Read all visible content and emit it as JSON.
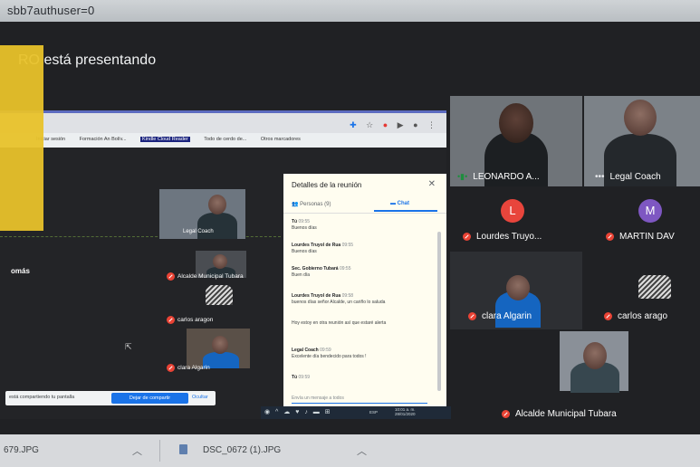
{
  "address": {
    "text": "sbb7authuser=0"
  },
  "meet": {
    "presenting_text": "RO está presentando",
    "side_name": "omás"
  },
  "shared_screen": {
    "bookmarks": [
      "Iniciar sesión",
      "Formación An Bolív...",
      "Kindle Cloud Reader",
      "Todo de cerdo de...",
      "Otros marcadores"
    ],
    "thumbs": [
      {
        "name": "Legal Coach"
      },
      {
        "name": "Alcalde Municipal Tubara"
      },
      {
        "name": "carlos aragon"
      },
      {
        "name": "clara Algarin"
      }
    ],
    "share_bar": {
      "text": "está compartiendo tu pantalla",
      "stop_label": "Dejar de compartir",
      "hide_label": "Ocultar"
    },
    "taskbar": {
      "time": "10:01 a. m.",
      "date": "28/01/2020",
      "lang": "ESP"
    }
  },
  "details_panel": {
    "title": "Detalles de la reunión",
    "tab_people": "Personas (9)",
    "tab_chat": "Chat",
    "messages": [
      {
        "sender": "Tú",
        "time": "09:55",
        "text": "Buenos días"
      },
      {
        "sender": "Lourdes Truyol de Rua",
        "time": "09:55",
        "text": "Buenos días"
      },
      {
        "sender": "Sec. Gobierno Tubará",
        "time": "09:55",
        "text": "Buen día"
      },
      {
        "sender": "Lourdes Truyol de Rua",
        "time": "09:58",
        "text": "buenos días señor Alcalde, un cariño lo saluda"
      },
      {
        "sender": "",
        "time": "",
        "text": "Hoy estoy en otra reunión así que estaré alerta"
      },
      {
        "sender": "Legal Coach",
        "time": "09:59",
        "text": "Excelente día bendecido para todos !"
      },
      {
        "sender": "Tú",
        "time": "09:59",
        "text": ""
      }
    ],
    "compose_placeholder": "Envía un mensaje a todos"
  },
  "participants": [
    {
      "name": "LEONARDO A...",
      "status": "speaking"
    },
    {
      "name": "Legal Coach",
      "status": "more"
    },
    {
      "name": "Lourdes Truyo...",
      "avatar": "L",
      "color": "#e8453c",
      "status": "muted"
    },
    {
      "name": "MARTIN DAV",
      "avatar": "M",
      "color": "#7e57c2",
      "status": "muted"
    },
    {
      "name": "clara Algarin",
      "status": "muted"
    },
    {
      "name": "carlos arago",
      "status": "muted"
    },
    {
      "name": "Alcalde Municipal Tubara",
      "status": "muted"
    }
  ],
  "downloads": {
    "item1": "679.JPG",
    "item2": "DSC_0672 (1).JPG"
  },
  "colors": {
    "accent": "#1a73e8",
    "muted": "#ea4335",
    "overlay": "#e8c22a"
  }
}
